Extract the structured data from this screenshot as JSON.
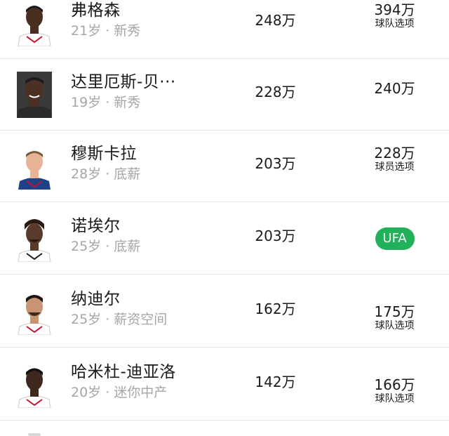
{
  "players": [
    {
      "name": "弗格森",
      "meta": "21岁 · 新秀",
      "salary": "248万",
      "next_value": "394万",
      "next_note": "球队选项",
      "jersey_color": "#ffffff",
      "skin_color": "#4a2e22"
    },
    {
      "name": "达里厄斯-贝···",
      "meta": "19岁 · 新秀",
      "salary": "228万",
      "next_value": "240万",
      "next_note": "",
      "jersey_color": "#2b2b2b",
      "skin_color": "#4d3024"
    },
    {
      "name": "穆斯卡拉",
      "meta": "28岁 · 底薪",
      "salary": "203万",
      "next_value": "228万",
      "next_note": "球员选项",
      "jersey_color": "#1d428a",
      "skin_color": "#e8b497"
    },
    {
      "name": "诺埃尔",
      "meta": "25岁 · 底薪",
      "salary": "203万",
      "next_value": "UFA",
      "next_note": "",
      "jersey_color": "#ffffff",
      "skin_color": "#5a3a2a"
    },
    {
      "name": "纳迪尔",
      "meta": "25岁 · 薪资空间",
      "salary": "162万",
      "next_value": "175万",
      "next_note": "球队选项",
      "jersey_color": "#ffffff",
      "skin_color": "#c99474"
    },
    {
      "name": "哈米杜-迪亚洛",
      "meta": "20岁 · 迷你中产",
      "salary": "142万",
      "next_value": "166万",
      "next_note": "球队选项",
      "jersey_color": "#ffffff",
      "skin_color": "#3e271d"
    }
  ],
  "colors": {
    "ufa_badge": "#20b15a",
    "name_text": "#1a1a1a",
    "meta_text": "#a6a6a6",
    "divider": "#e9e9e9"
  }
}
